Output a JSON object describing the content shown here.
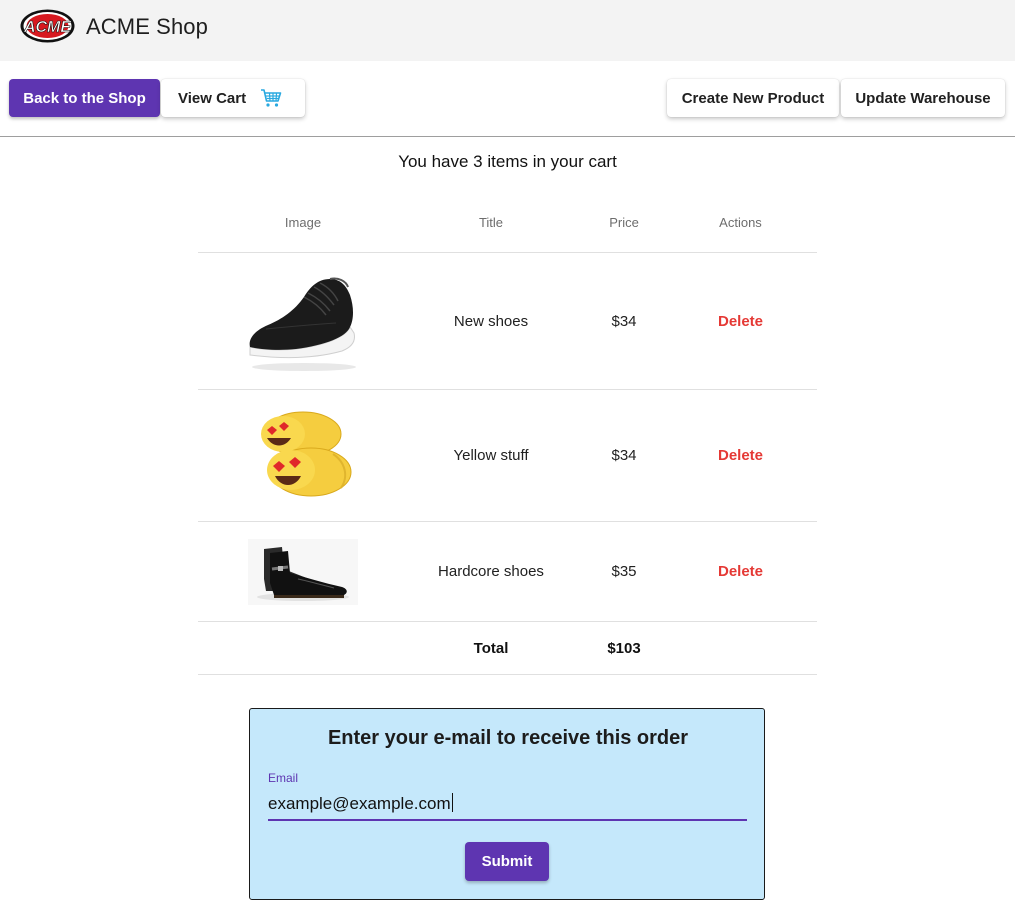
{
  "header": {
    "logo_text": "ACME",
    "title": "ACME Shop"
  },
  "toolbar": {
    "back_label": "Back to the Shop",
    "view_cart_label": "View Cart",
    "cart_icon": "shopping-cart-icon",
    "create_label": "Create New Product",
    "update_label": "Update Warehouse"
  },
  "cart": {
    "summary": "You have 3 items in your cart",
    "columns": [
      "Image",
      "Title",
      "Price",
      "Actions"
    ],
    "items": [
      {
        "title": "New shoes",
        "price": "$34",
        "action": "Delete",
        "image": "black-sneaker-image"
      },
      {
        "title": "Yellow stuff",
        "price": "$34",
        "action": "Delete",
        "image": "emoji-slippers-image"
      },
      {
        "title": "Hardcore shoes",
        "price": "$35",
        "action": "Delete",
        "image": "black-boot-image"
      }
    ],
    "total_label": "Total",
    "total_value": "$103"
  },
  "email_form": {
    "heading": "Enter your e-mail to receive this order",
    "label": "Email",
    "value": "example@example.com",
    "submit_label": "Submit"
  },
  "colors": {
    "primary": "#5e35b1",
    "delete": "#e53935",
    "card_bg": "#c5e8fb",
    "header_bg": "#f3f3f3",
    "cart_icon": "#29a9e0"
  }
}
